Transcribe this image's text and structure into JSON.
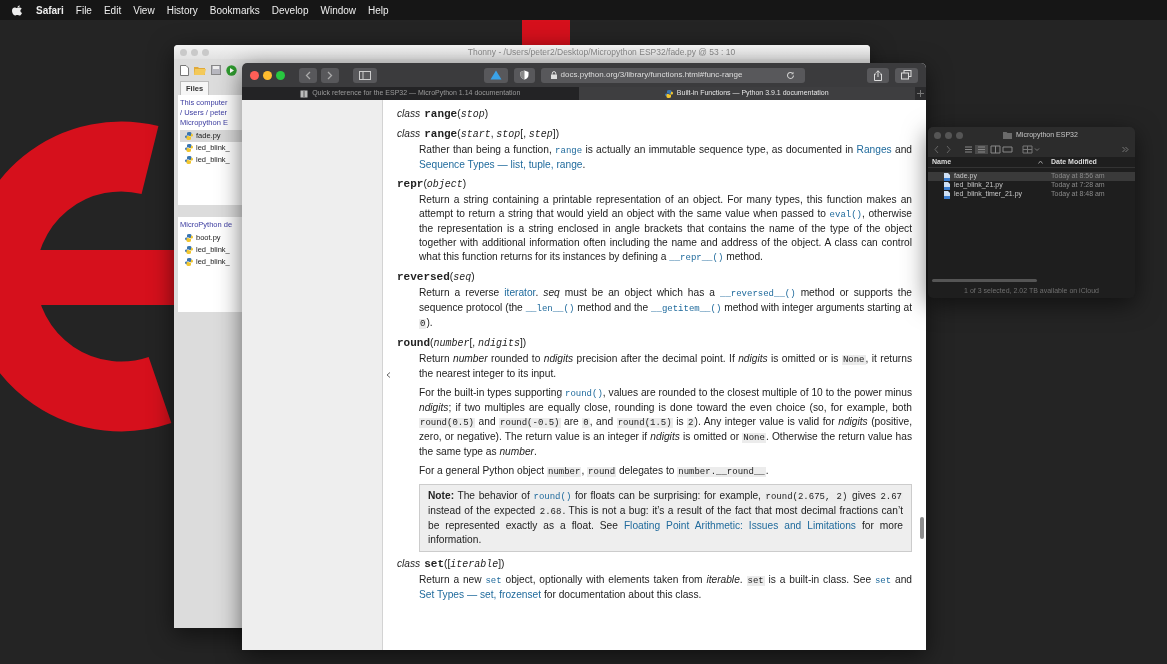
{
  "menubar": {
    "items": [
      {
        "label": "Safari",
        "kind": "app"
      },
      {
        "label": "File",
        "kind": "menu"
      },
      {
        "label": "Edit",
        "kind": "menu"
      },
      {
        "label": "View",
        "kind": "menu"
      },
      {
        "label": "History",
        "kind": "menu"
      },
      {
        "label": "Bookmarks",
        "kind": "menu"
      },
      {
        "label": "Develop",
        "kind": "menu"
      },
      {
        "label": "Window",
        "kind": "menu"
      },
      {
        "label": "Help",
        "kind": "menu"
      }
    ]
  },
  "thonny": {
    "title": "Thonny - /Users/peter2/Desktop/Micropython ESP32/fade.py @ 53 : 10",
    "tab": "Files",
    "panels": [
      {
        "path": [
          "This computer",
          "/ Users / peter",
          "Micropython E"
        ],
        "files": [
          {
            "name": "fade.py",
            "selected": true
          },
          {
            "name": "led_blink_",
            "selected": false
          },
          {
            "name": "led_blink_",
            "selected": false
          }
        ]
      },
      {
        "path": [
          "MicroPython de"
        ],
        "files": [
          {
            "name": "boot.py",
            "selected": false
          },
          {
            "name": "led_blink_",
            "selected": false
          },
          {
            "name": "led_blink_",
            "selected": false
          }
        ]
      }
    ]
  },
  "safari": {
    "url": "docs.python.org/3/library/functions.html#func-range",
    "tabs": [
      {
        "title": "Quick reference for the ESP32 — MicroPython 1.14 documentation",
        "selected": false
      },
      {
        "title": "Built-in Functions — Python 3.9.1 documentation",
        "selected": true
      }
    ],
    "blocks": [
      {
        "kind": "signature",
        "parts": [
          {
            "kind": "keyword",
            "text": "class"
          },
          {
            "kind": "name",
            "text": "range"
          },
          {
            "kind": "text",
            "text": "("
          },
          {
            "kind": "param",
            "text": "stop"
          },
          {
            "kind": "text",
            "text": ")"
          }
        ]
      },
      {
        "kind": "signature",
        "parts": [
          {
            "kind": "keyword",
            "text": "class"
          },
          {
            "kind": "name",
            "text": "range"
          },
          {
            "kind": "text",
            "text": "("
          },
          {
            "kind": "param",
            "text": "start"
          },
          {
            "kind": "text",
            "text": ", "
          },
          {
            "kind": "param",
            "text": "stop"
          },
          {
            "kind": "text",
            "text": "[, "
          },
          {
            "kind": "param",
            "text": "step"
          },
          {
            "kind": "text",
            "text": "])"
          }
        ]
      },
      {
        "kind": "para",
        "parts": [
          {
            "kind": "text",
            "text": "Rather than being a function, "
          },
          {
            "kind": "codelink",
            "text": "range"
          },
          {
            "kind": "text",
            "text": " is actually an immutable sequence type, as documented in "
          },
          {
            "kind": "link",
            "text": "Ranges"
          },
          {
            "kind": "text",
            "text": " and "
          },
          {
            "kind": "link",
            "text": "Sequence Types — list, tuple, range"
          },
          {
            "kind": "text",
            "text": "."
          }
        ]
      },
      {
        "kind": "signature",
        "parts": [
          {
            "kind": "name",
            "text": "repr"
          },
          {
            "kind": "text",
            "text": "("
          },
          {
            "kind": "param",
            "text": "object"
          },
          {
            "kind": "text",
            "text": ")"
          }
        ]
      },
      {
        "kind": "para",
        "parts": [
          {
            "kind": "text",
            "text": "Return a string containing a printable representation of an object. For many types, this function makes an attempt to return a string that would yield an object with the same value when passed to "
          },
          {
            "kind": "codelink",
            "text": "eval()"
          },
          {
            "kind": "text",
            "text": ", otherwise the representation is a string enclosed in angle brackets that contains the name of the type of the object together with additional information often including the name and address of the object. A class can control what this function returns for its instances by defining a "
          },
          {
            "kind": "codelink",
            "text": "__repr__()"
          },
          {
            "kind": "text",
            "text": " method."
          }
        ]
      },
      {
        "kind": "signature",
        "parts": [
          {
            "kind": "name",
            "text": "reversed"
          },
          {
            "kind": "text",
            "text": "("
          },
          {
            "kind": "param",
            "text": "seq"
          },
          {
            "kind": "text",
            "text": ")"
          }
        ]
      },
      {
        "kind": "para",
        "parts": [
          {
            "kind": "text",
            "text": "Return a reverse "
          },
          {
            "kind": "link",
            "text": "iterator"
          },
          {
            "kind": "text",
            "text": ". *seq* must be an object which has a "
          },
          {
            "kind": "codelink",
            "text": "__reversed__()"
          },
          {
            "kind": "text",
            "text": " method or supports the sequence protocol (the "
          },
          {
            "kind": "codelink",
            "text": "__len__()"
          },
          {
            "kind": "text",
            "text": " method and the "
          },
          {
            "kind": "codelink",
            "text": "__getitem__()"
          },
          {
            "kind": "text",
            "text": " method with integer arguments starting at "
          },
          {
            "kind": "code",
            "text": "0"
          },
          {
            "kind": "text",
            "text": ")."
          }
        ]
      },
      {
        "kind": "signature",
        "parts": [
          {
            "kind": "name",
            "text": "round"
          },
          {
            "kind": "text",
            "text": "("
          },
          {
            "kind": "param",
            "text": "number"
          },
          {
            "kind": "text",
            "text": "[, "
          },
          {
            "kind": "param",
            "text": "ndigits"
          },
          {
            "kind": "text",
            "text": "])"
          }
        ]
      },
      {
        "kind": "para",
        "parts": [
          {
            "kind": "text",
            "text": "Return *number* rounded to *ndigits* precision after the decimal point. If *ndigits* is omitted or is "
          },
          {
            "kind": "code",
            "text": "None"
          },
          {
            "kind": "text",
            "text": ", it returns the nearest integer to its input."
          }
        ]
      },
      {
        "kind": "para",
        "parts": [
          {
            "kind": "text",
            "text": "For the built-in types supporting "
          },
          {
            "kind": "codelink",
            "text": "round()"
          },
          {
            "kind": "text",
            "text": ", values are rounded to the closest multiple of 10 to the power minus *ndigits*; if two multiples are equally close, rounding is done toward the even choice (so, for example, both "
          },
          {
            "kind": "code",
            "text": "round(0.5)"
          },
          {
            "kind": "text",
            "text": " and "
          },
          {
            "kind": "code",
            "text": "round(-0.5)"
          },
          {
            "kind": "text",
            "text": " are "
          },
          {
            "kind": "code",
            "text": "0"
          },
          {
            "kind": "text",
            "text": ", and "
          },
          {
            "kind": "code",
            "text": "round(1.5)"
          },
          {
            "kind": "text",
            "text": " is "
          },
          {
            "kind": "code",
            "text": "2"
          },
          {
            "kind": "text",
            "text": "). Any integer value is valid for *ndigits* (positive, zero, or negative). The return value is an integer if *ndigits* is omitted or "
          },
          {
            "kind": "code",
            "text": "None"
          },
          {
            "kind": "text",
            "text": ". Otherwise the return value has the same type as *number*."
          }
        ]
      },
      {
        "kind": "para",
        "parts": [
          {
            "kind": "text",
            "text": "For a general Python object "
          },
          {
            "kind": "code",
            "text": "number"
          },
          {
            "kind": "text",
            "text": ", "
          },
          {
            "kind": "code",
            "text": "round"
          },
          {
            "kind": "text",
            "text": " delegates to "
          },
          {
            "kind": "code",
            "text": "number.__round__"
          },
          {
            "kind": "text",
            "text": "."
          }
        ]
      },
      {
        "kind": "note",
        "parts": [
          {
            "kind": "text",
            "text": "**Note:** The behavior of "
          },
          {
            "kind": "codelink",
            "text": "round()"
          },
          {
            "kind": "text",
            "text": " for floats can be surprising: for example, "
          },
          {
            "kind": "code",
            "text": "round(2.675, 2)"
          },
          {
            "kind": "text",
            "text": " gives "
          },
          {
            "kind": "code",
            "text": "2.67"
          },
          {
            "kind": "text",
            "text": " instead of the expected "
          },
          {
            "kind": "code",
            "text": "2.68"
          },
          {
            "kind": "text",
            "text": ". This is not a bug: it’s a result of the fact that most decimal fractions can’t be represented exactly as a float. See "
          },
          {
            "kind": "link",
            "text": "Floating Point Arithmetic: Issues and Limitations"
          },
          {
            "kind": "text",
            "text": " for more information."
          }
        ]
      },
      {
        "kind": "signature",
        "parts": [
          {
            "kind": "keyword",
            "text": "class"
          },
          {
            "kind": "name",
            "text": "set"
          },
          {
            "kind": "text",
            "text": "(["
          },
          {
            "kind": "param",
            "text": "iterable"
          },
          {
            "kind": "text",
            "text": "])"
          }
        ]
      },
      {
        "kind": "para",
        "parts": [
          {
            "kind": "text",
            "text": "Return a new "
          },
          {
            "kind": "codelink",
            "text": "set"
          },
          {
            "kind": "text",
            "text": " object, optionally with elements taken from *iterable*. "
          },
          {
            "kind": "code",
            "text": "set"
          },
          {
            "kind": "text",
            "text": " is a built-in class. See "
          },
          {
            "kind": "codelink",
            "text": "set"
          },
          {
            "kind": "text",
            "text": " and "
          },
          {
            "kind": "link",
            "text": "Set Types — set, frozenset"
          },
          {
            "kind": "text",
            "text": " for documentation about this class."
          }
        ]
      }
    ]
  },
  "finder": {
    "title": "Micropython ESP32",
    "columns": [
      "Name",
      "Date Modified"
    ],
    "rows": [
      {
        "name": "fade.py",
        "modified": "Today at 8:56 am",
        "selected": true
      },
      {
        "name": "led_blink_21.py",
        "modified": "Today at 7:28 am",
        "selected": false
      },
      {
        "name": "led_blink_timer_21.py",
        "modified": "Today at 8:48 am",
        "selected": false
      }
    ],
    "status": "1 of 3 selected, 2.02 TB available on iCloud"
  }
}
